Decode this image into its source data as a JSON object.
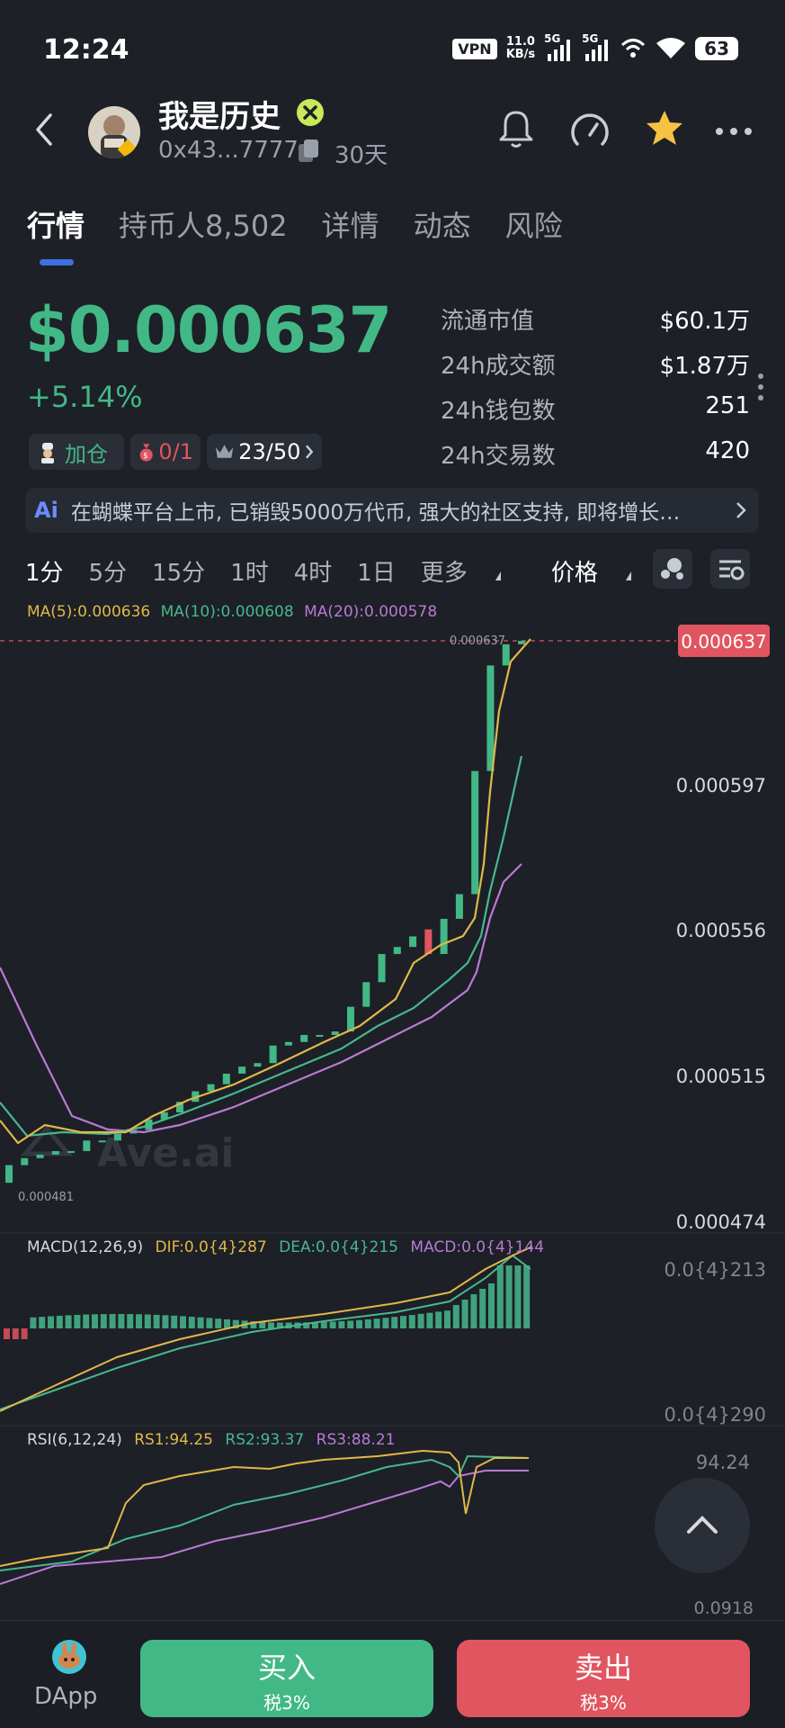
{
  "status_bar": {
    "time": "12:24",
    "vpn": "VPN",
    "speed_value": "11.0",
    "speed_unit": "KB/s",
    "net1": "5G",
    "net2": "5G",
    "battery": "63"
  },
  "header": {
    "token_name": "我是历史",
    "address": "0x43...7777",
    "age": "30天"
  },
  "tabs": [
    {
      "label": "行情",
      "active": true
    },
    {
      "label": "持币人8,502",
      "active": false
    },
    {
      "label": "详情",
      "active": false
    },
    {
      "label": "动态",
      "active": false
    },
    {
      "label": "风险",
      "active": false
    }
  ],
  "price": {
    "value": "$0.000637",
    "change": "+5.14%"
  },
  "chips": {
    "add_position": "加仓",
    "bag_count": "0/1",
    "top_rank": "23/50"
  },
  "stats": [
    {
      "label": "流通市值",
      "value": "$60.1万"
    },
    {
      "label": "24h成交额",
      "value": "$1.87万"
    },
    {
      "label": "24h钱包数",
      "value": "251"
    },
    {
      "label": "24h交易数",
      "value": "420"
    }
  ],
  "ai_banner": {
    "icon": "Ai",
    "text": "在蝴蝶平台上市, 已销毁5000万代币, 强大的社区支持, 即将增长…"
  },
  "intervals": [
    {
      "label": "1分",
      "active": true
    },
    {
      "label": "5分",
      "active": false
    },
    {
      "label": "15分",
      "active": false
    },
    {
      "label": "1时",
      "active": false
    },
    {
      "label": "4时",
      "active": false
    },
    {
      "label": "1日",
      "active": false
    },
    {
      "label": "更多",
      "active": false
    },
    {
      "label": "价格",
      "active": true
    }
  ],
  "indicators": {
    "ma5": "MA(5):0.000636",
    "ma10": "MA(10):0.000608",
    "ma20": "MA(20):0.000578",
    "macd_title": "MACD(12,26,9)",
    "dif": "DIF:0.0{4}287",
    "dea": "DEA:0.0{4}215",
    "macd": "MACD:0.0{4}144",
    "rsi_title": "RSI(6,12,24)",
    "rs1": "RS1:94.25",
    "rs2": "RS2:93.37",
    "rs3": "RS3:88.21"
  },
  "chart_data": {
    "type": "candlestick",
    "y_axis_labels": [
      "0.000597",
      "0.000556",
      "0.000515",
      "0.000474"
    ],
    "last_price_label": "0.000637",
    "high_label": "0.000637",
    "low_label": "0.000481",
    "watermark": "Ave.ai",
    "macd_axis": [
      "0.0{4}213",
      "0.0{4}290"
    ],
    "rsi_axis": [
      "94.24",
      "0.0918"
    ],
    "candles": [
      {
        "o": 0.000483,
        "c": 0.000488
      },
      {
        "o": 0.000488,
        "c": 0.00049
      },
      {
        "o": 0.00049,
        "c": 0.000491
      },
      {
        "o": 0.000491,
        "c": 0.000492
      },
      {
        "o": 0.000492,
        "c": 0.000492
      },
      {
        "o": 0.000492,
        "c": 0.000495
      },
      {
        "o": 0.000495,
        "c": 0.000495
      },
      {
        "o": 0.000495,
        "c": 0.000497
      },
      {
        "o": 0.000497,
        "c": 0.000498
      },
      {
        "o": 0.000498,
        "c": 0.000501
      },
      {
        "o": 0.000501,
        "c": 0.000503
      },
      {
        "o": 0.000503,
        "c": 0.000506
      },
      {
        "o": 0.000506,
        "c": 0.000509
      },
      {
        "o": 0.000509,
        "c": 0.000511
      },
      {
        "o": 0.000511,
        "c": 0.000514
      },
      {
        "o": 0.000514,
        "c": 0.000516
      },
      {
        "o": 0.000516,
        "c": 0.000517
      },
      {
        "o": 0.000517,
        "c": 0.000522
      },
      {
        "o": 0.000522,
        "c": 0.000523
      },
      {
        "o": 0.000523,
        "c": 0.000525
      },
      {
        "o": 0.000525,
        "c": 0.000525
      },
      {
        "o": 0.000525,
        "c": 0.000526
      },
      {
        "o": 0.000526,
        "c": 0.000533
      },
      {
        "o": 0.000533,
        "c": 0.00054
      },
      {
        "o": 0.00054,
        "c": 0.000548
      },
      {
        "o": 0.000548,
        "c": 0.00055
      },
      {
        "o": 0.00055,
        "c": 0.000553
      },
      {
        "o": 0.000555,
        "c": 0.000548
      },
      {
        "o": 0.000548,
        "c": 0.000558
      },
      {
        "o": 0.000558,
        "c": 0.000565
      },
      {
        "o": 0.000565,
        "c": 0.0006
      },
      {
        "o": 0.0006,
        "c": 0.00063
      },
      {
        "o": 0.00063,
        "c": 0.000636
      },
      {
        "o": 0.000636,
        "c": 0.000637
      }
    ]
  },
  "bottom": {
    "dapp": "DApp",
    "buy": "买入",
    "buy_tax": "税3%",
    "sell": "卖出",
    "sell_tax": "税3%"
  },
  "colors": {
    "up": "#42b887",
    "down": "#e0555f",
    "ma5": "#e0b84a",
    "ma10": "#46b88e",
    "ma20": "#b979d6",
    "accent": "#3f6fe0"
  }
}
